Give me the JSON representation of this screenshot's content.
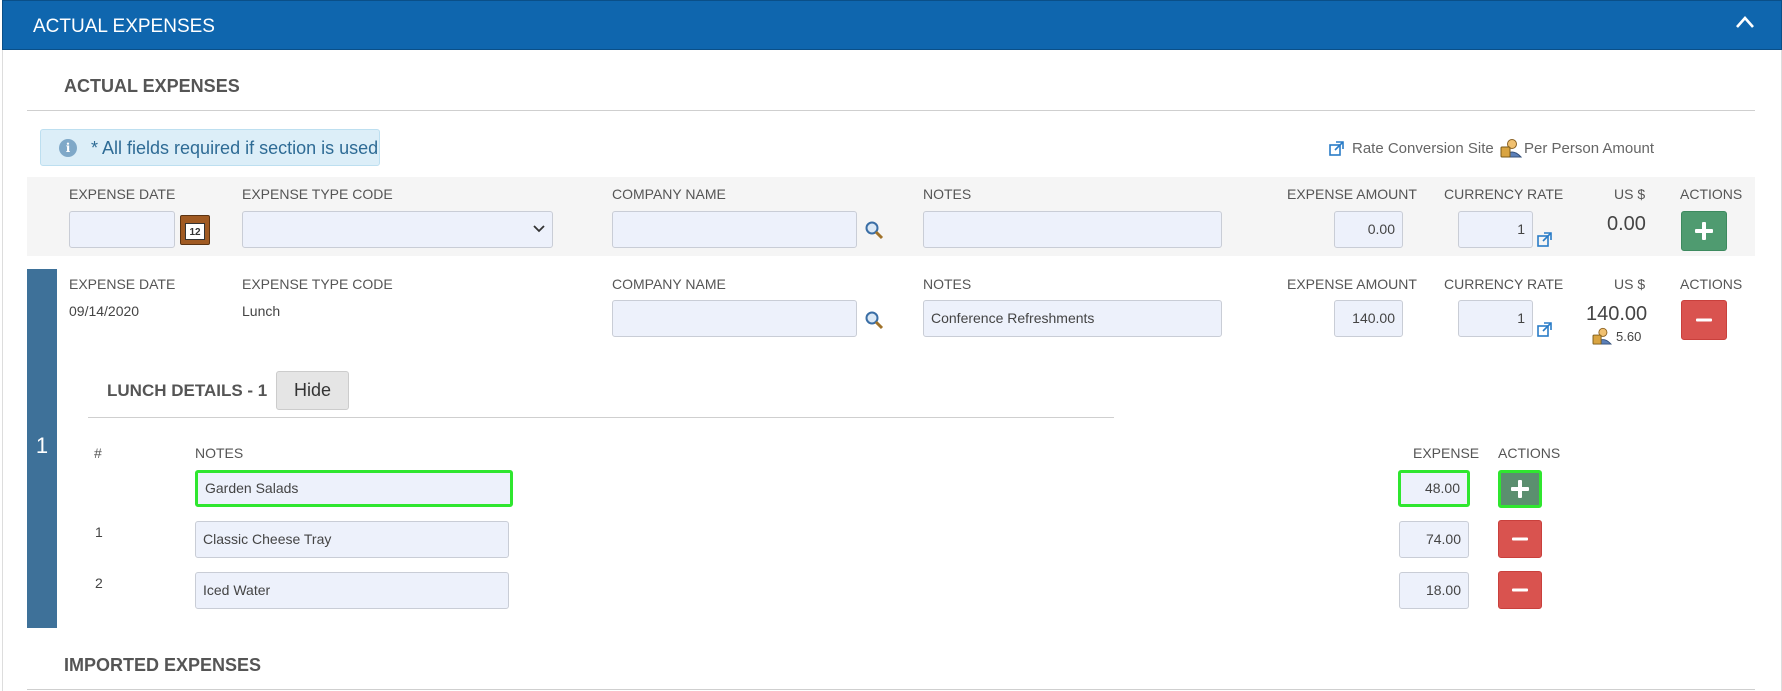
{
  "panel": {
    "title": "ACTUAL EXPENSES"
  },
  "section": {
    "title": "ACTUAL EXPENSES",
    "info": "* All fields required if section is used",
    "links": {
      "rate_conversion": "Rate Conversion Site",
      "per_person": "Per Person Amount"
    }
  },
  "columns": {
    "expense_date": "EXPENSE DATE",
    "expense_type": "EXPENSE TYPE CODE",
    "company_name": "COMPANY NAME",
    "notes": "NOTES",
    "expense_amount": "EXPENSE AMOUNT",
    "currency_rate": "CURRENCY RATE",
    "usd": "US $",
    "actions": "ACTIONS"
  },
  "new_row": {
    "expense_date": "",
    "expense_type": "",
    "company_name": "",
    "notes": "",
    "expense_amount": "0.00",
    "currency_rate": "1",
    "usd": "0.00"
  },
  "expense": {
    "index": "1",
    "expense_date": "09/14/2020",
    "expense_type": "Lunch",
    "company_name": "",
    "notes": "Conference Refreshments",
    "expense_amount": "140.00",
    "currency_rate": "1",
    "usd": "140.00",
    "per_person": "5.60"
  },
  "details": {
    "title": "LUNCH DETAILS - 1",
    "hide_label": "Hide",
    "columns": {
      "num": "#",
      "notes": "NOTES",
      "expense": "EXPENSE",
      "actions": "ACTIONS"
    },
    "new_item": {
      "notes": "Garden Salads",
      "expense": "48.00"
    },
    "items": [
      {
        "num": "1",
        "notes": "Classic Cheese Tray",
        "expense": "74.00"
      },
      {
        "num": "2",
        "notes": "Iced Water",
        "expense": "18.00"
      }
    ]
  },
  "imported": {
    "title": "IMPORTED EXPENSES"
  },
  "colors": {
    "header": "#0f66ae",
    "add": "#4f9b70",
    "delete": "#d9534f",
    "highlight": "#2fe62f",
    "row_bar": "#3e7199"
  }
}
